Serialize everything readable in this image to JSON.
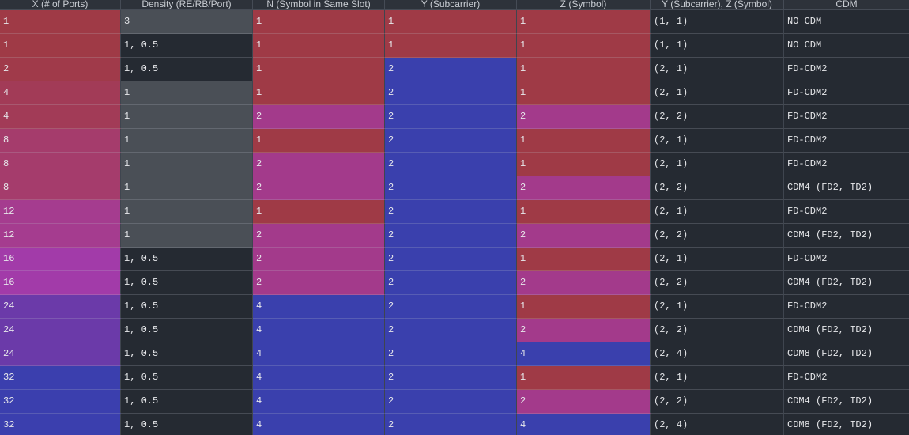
{
  "table": {
    "columns": [
      "X (# of Ports)",
      "Density (RE/RB/Port)",
      "N (Symbol in Same Slot)",
      "Y (Subcarrier)",
      "Z (Symbol)",
      "Y (Subcarrier), Z (Symbol)",
      "CDM"
    ],
    "rows": [
      [
        "1",
        "3",
        "1",
        "1",
        "1",
        "(1, 1)",
        "NO CDM"
      ],
      [
        "1",
        "1, 0.5",
        "1",
        "1",
        "1",
        "(1, 1)",
        "NO CDM"
      ],
      [
        "2",
        "1, 0.5",
        "1",
        "2",
        "1",
        "(2, 1)",
        "FD-CDM2"
      ],
      [
        "4",
        "1",
        "1",
        "2",
        "1",
        "(2, 1)",
        "FD-CDM2"
      ],
      [
        "4",
        "1",
        "2",
        "2",
        "2",
        "(2, 2)",
        "FD-CDM2"
      ],
      [
        "8",
        "1",
        "1",
        "2",
        "1",
        "(2, 1)",
        "FD-CDM2"
      ],
      [
        "8",
        "1",
        "2",
        "2",
        "1",
        "(2, 1)",
        "FD-CDM2"
      ],
      [
        "8",
        "1",
        "2",
        "2",
        "2",
        "(2, 2)",
        "CDM4 (FD2, TD2)"
      ],
      [
        "12",
        "1",
        "1",
        "2",
        "1",
        "(2, 1)",
        "FD-CDM2"
      ],
      [
        "12",
        "1",
        "2",
        "2",
        "2",
        "(2, 2)",
        "CDM4 (FD2, TD2)"
      ],
      [
        "16",
        "1, 0.5",
        "2",
        "2",
        "1",
        "(2, 1)",
        "FD-CDM2"
      ],
      [
        "16",
        "1, 0.5",
        "2",
        "2",
        "2",
        "(2, 2)",
        "CDM4 (FD2, TD2)"
      ],
      [
        "24",
        "1, 0.5",
        "4",
        "2",
        "1",
        "(2, 1)",
        "FD-CDM2"
      ],
      [
        "24",
        "1, 0.5",
        "4",
        "2",
        "2",
        "(2, 2)",
        "CDM4 (FD2, TD2)"
      ],
      [
        "24",
        "1, 0.5",
        "4",
        "2",
        "4",
        "(2, 4)",
        "CDM8 (FD2, TD2)"
      ],
      [
        "32",
        "1, 0.5",
        "4",
        "2",
        "1",
        "(2, 1)",
        "FD-CDM2"
      ],
      [
        "32",
        "1, 0.5",
        "4",
        "2",
        "2",
        "(2, 2)",
        "CDM4 (FD2, TD2)"
      ],
      [
        "32",
        "1, 0.5",
        "4",
        "2",
        "4",
        "(2, 4)",
        "CDM8 (FD2, TD2)"
      ]
    ]
  },
  "colors": {
    "background": "#252a32",
    "header_background": "#2d323a",
    "header_text": "#c9cdd3",
    "cell_text": "#e6e7ea"
  },
  "column_fills": [
    {
      "1": "#9f3a46",
      "2": "#a03a4a",
      "4": "#a23b57",
      "8": "#a53c6c",
      "12": "#a53c8f",
      "16": "#a23ba9",
      "24": "#6b3aa9",
      "32": "#3b3fae"
    },
    {
      "3": "#4a4f56",
      "1": "#4a4f56",
      "1, 0.5": "#252a32"
    },
    {
      "1": "#9f3a46",
      "2": "#a33a8b",
      "4": "#3a40ad"
    },
    {
      "1": "#9f3a46",
      "2": "#3a40ad"
    },
    {
      "1": "#9f3a46",
      "2": "#a33a8b",
      "4": "#3a40ad"
    },
    null,
    null
  ]
}
